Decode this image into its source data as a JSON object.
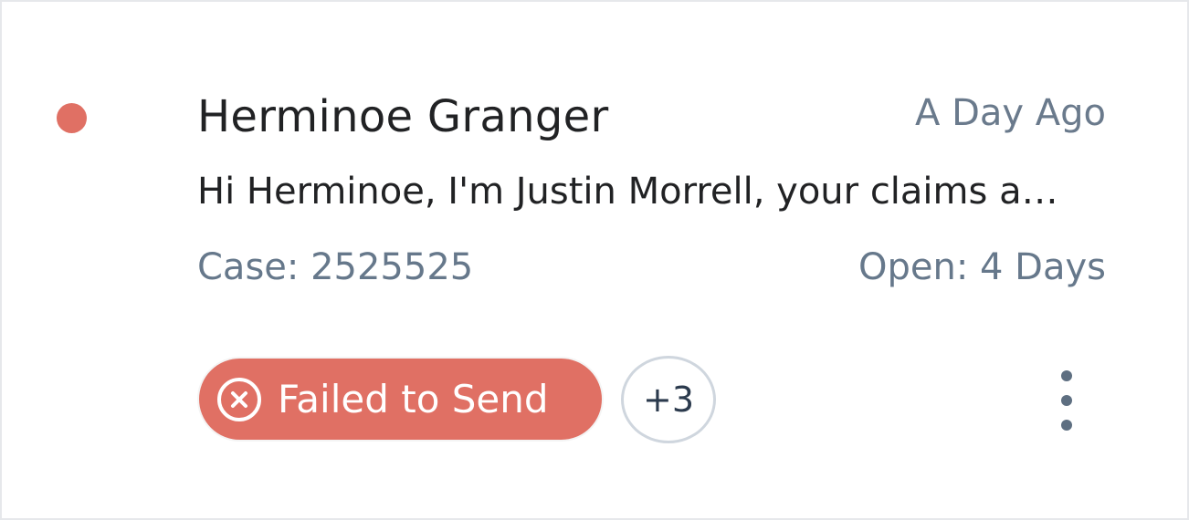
{
  "card": {
    "contact_name": "Herminoe Granger",
    "time_ago": "A Day Ago",
    "message_preview": "Hi Herminoe, I'm Justin Morrell, your claims adjuster",
    "case_label": "Case: 2525525",
    "open_duration": "Open: 4 Days",
    "status_badge": {
      "label": "Failed to Send",
      "icon": "x-circle-icon",
      "color": "#e07064"
    },
    "more_tags_label": "+3",
    "unread_indicator_color": "#e07064",
    "menu_icon": "kebab-vertical-icon"
  }
}
